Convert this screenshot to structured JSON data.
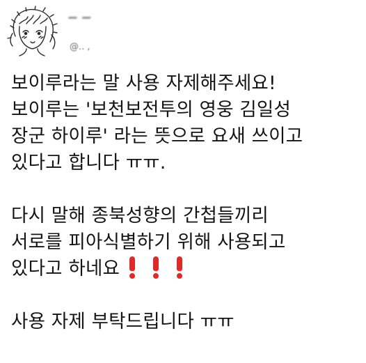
{
  "header": {
    "avatar_icon": "sketch-girl-avatar-icon",
    "user_name": "ㅡ ㅡ",
    "handle": "@..   ,"
  },
  "tweet": {
    "lines_p1": [
      "보이루라는 말 사용 자제해주세요!",
      "보이루는 '보천보전투의 영웅 김일성",
      "장군 하이루' 라는 뜻으로 요새 쓰이고",
      "있다고 합니다 ㅠㅠ."
    ],
    "lines_p2": [
      "다시 말해 종북성향의 간첩들끼리",
      "서로를 피아식별하기 위해 사용되고",
      "있다고 하네요"
    ],
    "lines_p3": [
      "사용 자제 부탁드립니다 ㅠㅠ"
    ],
    "emphasis_icon": "red-exclamation-icon",
    "emphasis_count": 3,
    "emphasis_color": "#e02a2a"
  }
}
